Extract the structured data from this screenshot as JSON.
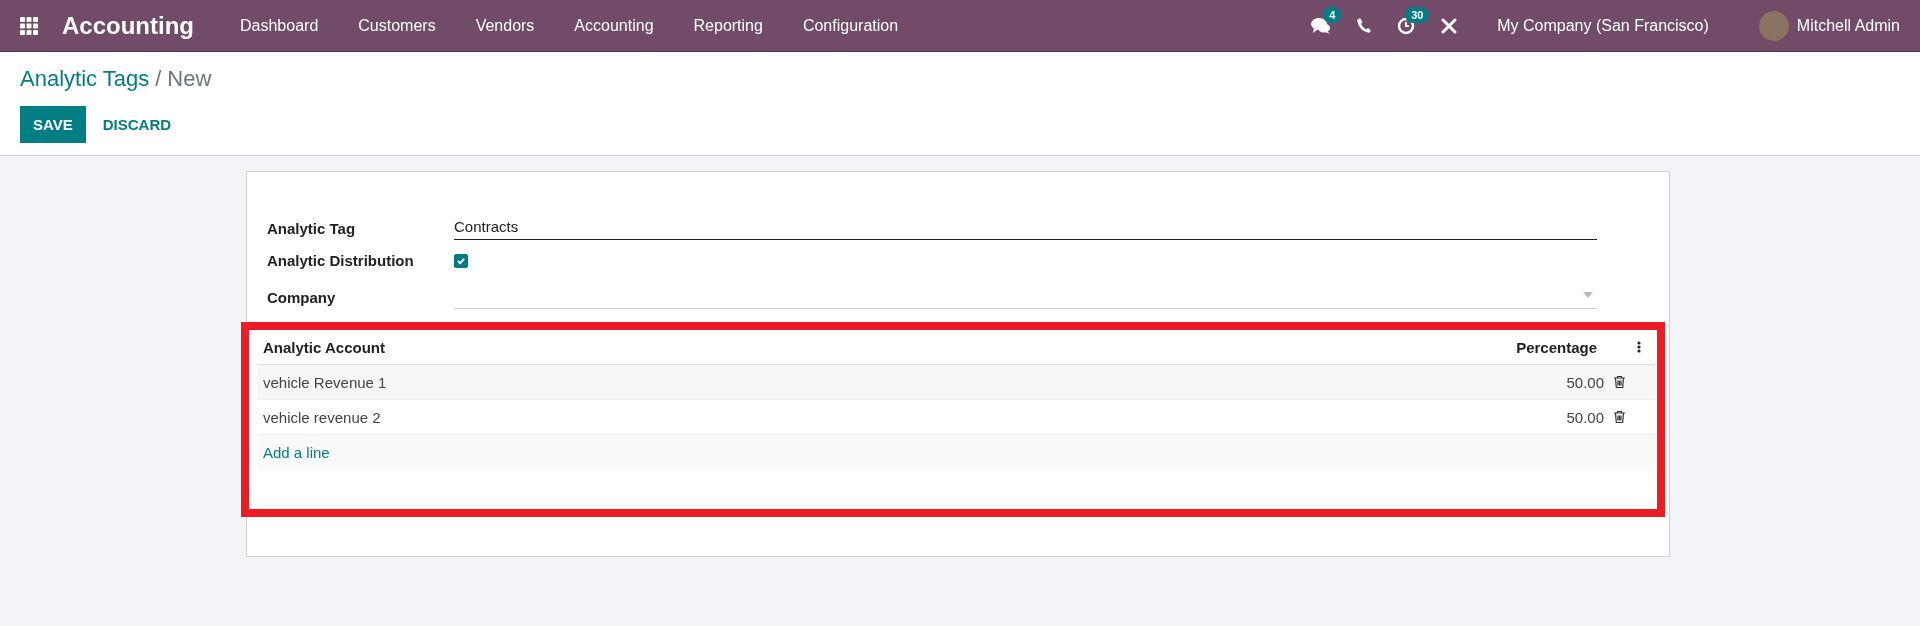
{
  "navbar": {
    "app_name": "Accounting",
    "menu": [
      "Dashboard",
      "Customers",
      "Vendors",
      "Accounting",
      "Reporting",
      "Configuration"
    ],
    "messages_badge": "4",
    "activities_badge": "30",
    "company": "My Company (San Francisco)",
    "user": "Mitchell Admin"
  },
  "breadcrumb": {
    "parent": "Analytic Tags",
    "separator": "/",
    "current": "New"
  },
  "buttons": {
    "save": "SAVE",
    "discard": "DISCARD"
  },
  "form": {
    "fields": [
      {
        "kind": "text",
        "label": "Analytic Tag",
        "value": "Contracts"
      },
      {
        "kind": "checkbox",
        "label": "Analytic Distribution",
        "checked": true
      },
      {
        "kind": "select",
        "label": "Company"
      }
    ],
    "distribution": {
      "highlighted": true,
      "columns": [
        "Analytic Account",
        "Percentage"
      ],
      "rows": [
        {
          "account": "vehicle Revenue 1",
          "percentage": "50.00"
        },
        {
          "account": "vehicle revenue 2",
          "percentage": "50.00"
        }
      ],
      "add_line": "Add a line"
    }
  }
}
